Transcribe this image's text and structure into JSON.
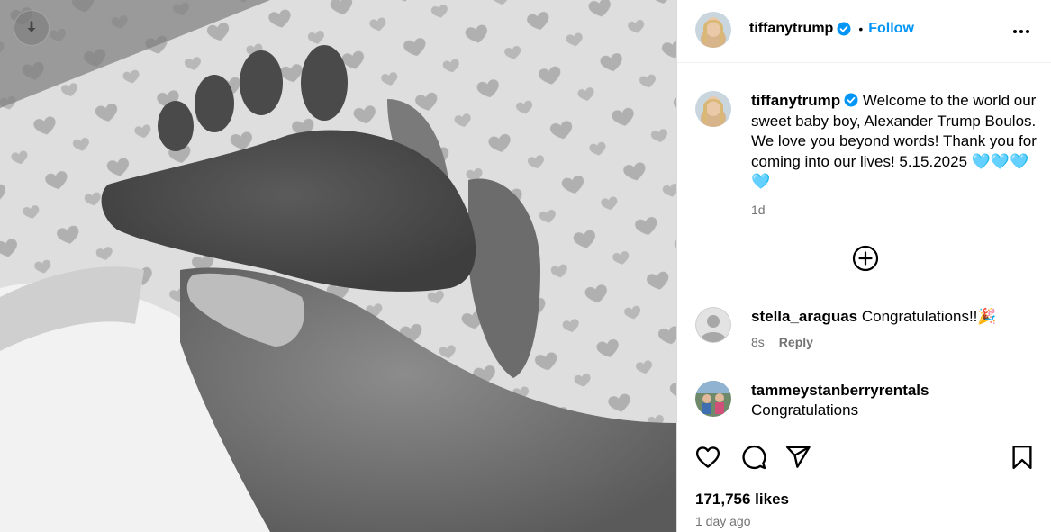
{
  "header": {
    "username": "tiffanytrump",
    "dot": "•",
    "follow_label": "Follow"
  },
  "caption": {
    "username": "tiffanytrump",
    "text": "Welcome to the world our sweet baby boy, Alexander Trump Boulos. We love you beyond words! Thank you for coming into our lives! 5.15.2025 ",
    "emoji": "🩵🩵🩵🩵",
    "time": "1d"
  },
  "comments": [
    {
      "username": "stella_araguas",
      "text": "Congratulations!!",
      "emoji": "🎉",
      "time": "8s",
      "reply_label": "Reply"
    },
    {
      "username": "tammeystanberryrentals",
      "text": "Congratulations"
    }
  ],
  "footer": {
    "likes": "171,756 likes",
    "posted": "1 day ago"
  },
  "icons": [
    "download-icon",
    "verified-icon",
    "more-icon",
    "add-circle-icon",
    "heart-icon",
    "comment-icon",
    "share-icon",
    "bookmark-icon"
  ],
  "colors": {
    "accent": "#0095f6",
    "verified": "#0095f6",
    "muted": "#737373"
  }
}
